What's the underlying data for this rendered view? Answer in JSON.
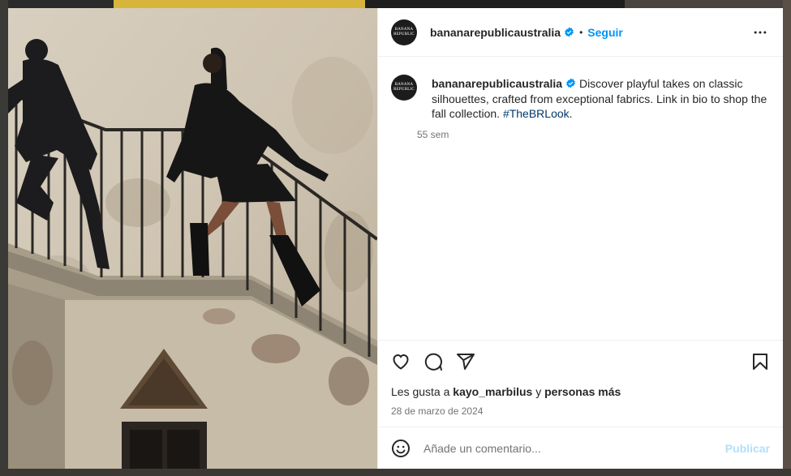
{
  "post": {
    "username": "bananarepublicaustralia",
    "avatar_text": "BANANA REPUBLIC",
    "follow_label": "Seguir",
    "separator": "•",
    "caption_text": "Discover playful takes on classic silhouettes, crafted from exceptional fabrics. Link in bio to shop the fall collection.",
    "hashtag": "#TheBRLook",
    "caption_end": ".",
    "time_ago": "55 sem",
    "likes_prefix": "Les gusta a",
    "likes_user": "kayo_marbilus",
    "likes_joiner": "y",
    "likes_others": "personas más",
    "date": "28 de marzo de 2024"
  },
  "comment": {
    "placeholder": "Añade un comentario...",
    "publish_label": "Publicar"
  },
  "icons": {
    "verified": "verified-badge-icon",
    "more": "more-options-icon",
    "like": "heart-icon",
    "comment": "comment-icon",
    "share": "share-icon",
    "save": "bookmark-icon",
    "emoji": "emoji-icon"
  },
  "colors": {
    "accent": "#0095f6",
    "publish_disabled": "#b2dffc",
    "hashtag": "#00376b",
    "muted": "#737373"
  }
}
